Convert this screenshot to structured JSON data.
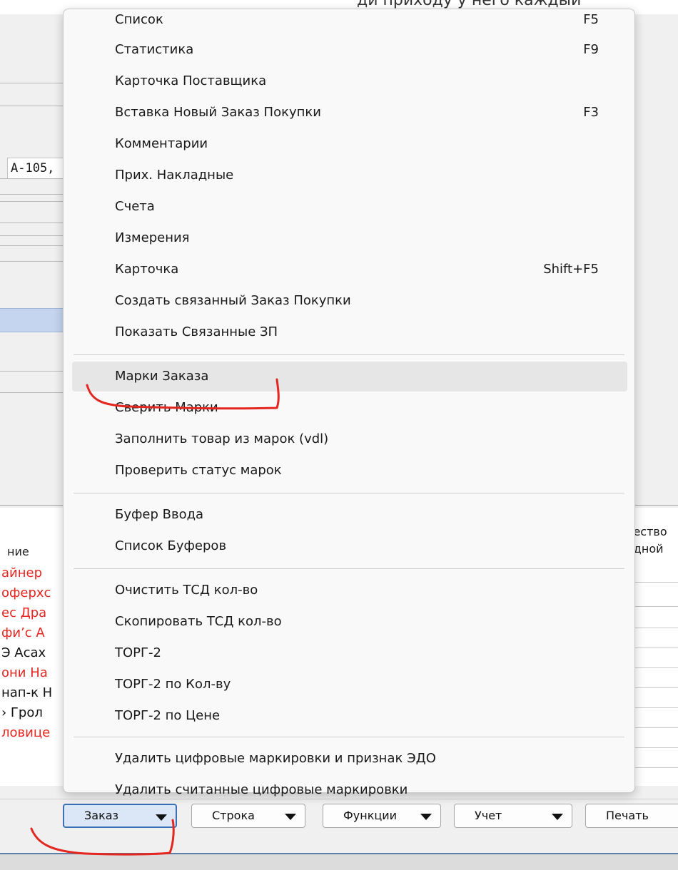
{
  "window": {
    "top_text": "ди приходу у него каждый"
  },
  "form": {
    "address_fragment": "А-105,"
  },
  "grid": {
    "header_name": "ние",
    "header_right_1": "чество",
    "header_right_2": "адной",
    "rows": [
      {
        "text": "айнер",
        "color": "red"
      },
      {
        "text": "оферхс",
        "color": "red"
      },
      {
        "text": "ес Дра",
        "color": "red"
      },
      {
        "text": "фи’с А",
        "color": "red"
      },
      {
        "text": "Э Асах",
        "color": "black"
      },
      {
        "text": "они На",
        "color": "red"
      },
      {
        "text": "нап-к Н",
        "color": "black"
      },
      {
        "text": "› Грол",
        "color": "black"
      },
      {
        "text": "ловице",
        "color": "red"
      }
    ]
  },
  "menu": {
    "items": [
      {
        "label": "Список",
        "shortcut": "F5"
      },
      {
        "label": "Статистика",
        "shortcut": "F9"
      },
      {
        "label": "Карточка Поставщика",
        "shortcut": ""
      },
      {
        "label": "Вставка Новый Заказ Покупки",
        "shortcut": "F3"
      },
      {
        "label": "Комментарии",
        "shortcut": ""
      },
      {
        "label": "Прих. Накладные",
        "shortcut": ""
      },
      {
        "label": "Счета",
        "shortcut": ""
      },
      {
        "label": "Измерения",
        "shortcut": ""
      },
      {
        "label": "Карточка",
        "shortcut": "Shift+F5"
      },
      {
        "label": "Создать связанный Заказ Покупки",
        "shortcut": ""
      },
      {
        "label": "Показать Связанные ЗП",
        "shortcut": ""
      },
      {
        "label": "Марки Заказа",
        "shortcut": ""
      },
      {
        "label": "Сверить Марки",
        "shortcut": ""
      },
      {
        "label": "Заполнить товар из марок (vdl)",
        "shortcut": ""
      },
      {
        "label": "Проверить статус марок",
        "shortcut": ""
      },
      {
        "label": "Буфер Ввода",
        "shortcut": ""
      },
      {
        "label": "Список Буферов",
        "shortcut": ""
      },
      {
        "label": "Очистить ТСД кол-во",
        "shortcut": ""
      },
      {
        "label": "Скопировать ТСД кол-во",
        "shortcut": ""
      },
      {
        "label": "ТОРГ-2",
        "shortcut": ""
      },
      {
        "label": "ТОРГ-2 по Кол-ву",
        "shortcut": ""
      },
      {
        "label": "ТОРГ-2 по Цене",
        "shortcut": ""
      },
      {
        "label": "Удалить цифровые маркировки и признак ЭДО",
        "shortcut": ""
      },
      {
        "label": "Удалить считанные цифровые маркировки",
        "shortcut": ""
      }
    ],
    "highlighted_item": "Марки Заказа"
  },
  "toolbar": {
    "buttons": [
      {
        "label": "Заказ",
        "active": true
      },
      {
        "label": "Строка",
        "active": false
      },
      {
        "label": "Функции",
        "active": false
      },
      {
        "label": "Учет",
        "active": false
      },
      {
        "label": "Печать",
        "active": false
      }
    ]
  },
  "colors": {
    "annotation": "#e3261f",
    "menu_highlight": "#e6e6e6",
    "grid_red_text": "#e3261f",
    "active_button_border": "#3b6fb6"
  }
}
